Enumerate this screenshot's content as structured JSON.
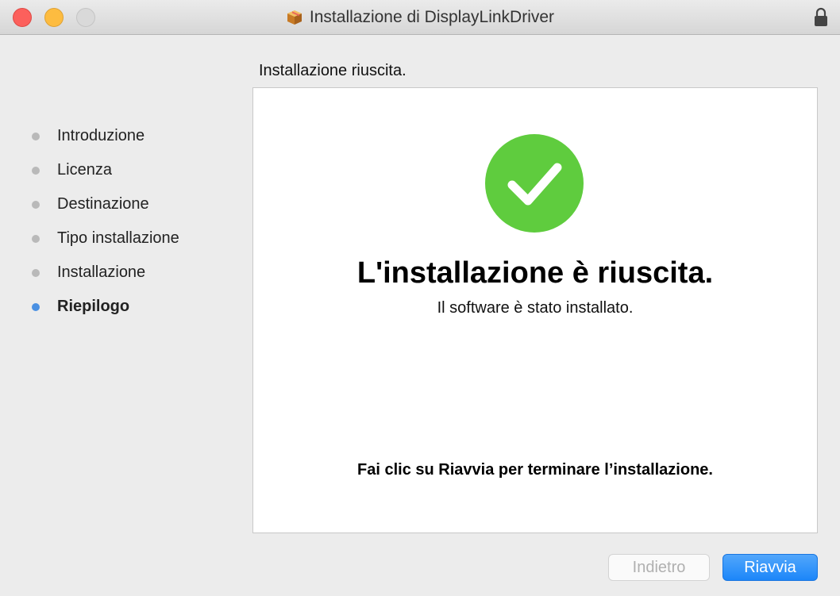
{
  "window": {
    "title": "Installazione di DisplayLinkDriver"
  },
  "sidebar": {
    "items": [
      {
        "label": "Introduzione",
        "active": false
      },
      {
        "label": "Licenza",
        "active": false
      },
      {
        "label": "Destinazione",
        "active": false
      },
      {
        "label": "Tipo installazione",
        "active": false
      },
      {
        "label": "Installazione",
        "active": false
      },
      {
        "label": "Riepilogo",
        "active": true
      }
    ]
  },
  "main": {
    "header": "Installazione riuscita.",
    "success_title": "L'installazione è riuscita.",
    "success_subtitle": "Il software è stato installato.",
    "restart_note": "Fai clic su Riavvia per terminare l’installazione."
  },
  "buttons": {
    "back_label": "Indietro",
    "restart_label": "Riavvia"
  },
  "colors": {
    "accent": "#1c86f9",
    "success": "#5fcc3e",
    "step_active": "#4a90e2",
    "step_inactive": "#b9b9b9"
  },
  "icons": {
    "titlebar": "package-icon",
    "lock": "lock-icon",
    "status": "checkmark-circle-icon"
  }
}
